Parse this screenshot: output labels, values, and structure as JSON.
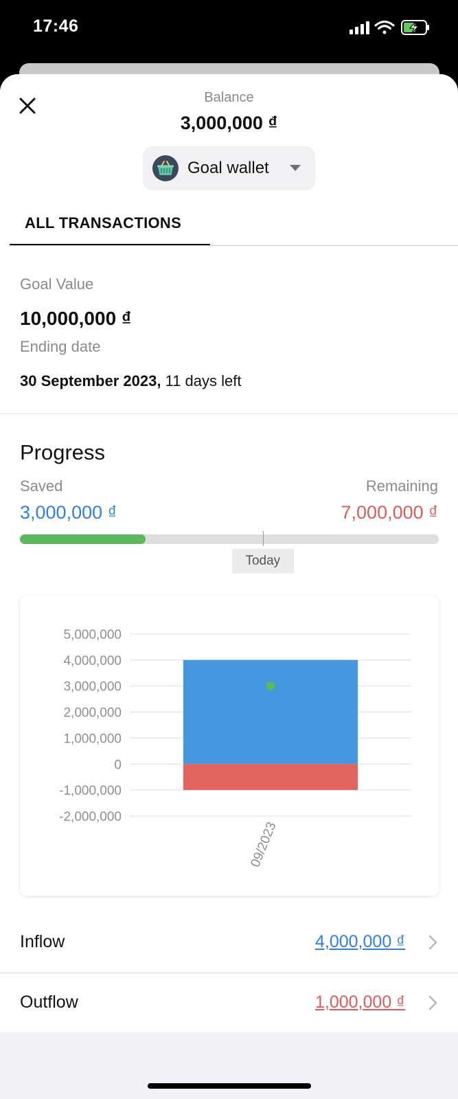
{
  "status_bar": {
    "time": "17:46"
  },
  "header": {
    "balance_label": "Balance",
    "balance_value": "3,000,000 ₫",
    "wallet_name": "Goal wallet",
    "wallet_icon": "basket-icon"
  },
  "tabs": {
    "all_transactions": "ALL TRANSACTIONS"
  },
  "goal": {
    "goal_value_label": "Goal Value",
    "goal_value": "10,000,000 ₫",
    "ending_date_label": "Ending date",
    "ending_date": "30 September 2023,",
    "days_left": "11 days left"
  },
  "progress": {
    "title": "Progress",
    "saved_label": "Saved",
    "saved_value": "3,000,000 ₫",
    "remaining_label": "Remaining",
    "remaining_value": "7,000,000 ₫",
    "fraction_saved": 0.3,
    "today_label": "Today",
    "today_fraction": 0.58
  },
  "chart_data": {
    "type": "bar",
    "categories": [
      "09/2023"
    ],
    "series": [
      {
        "values": [
          4000000
        ],
        "color": "#4598e0"
      },
      {
        "values": [
          -1000000
        ],
        "color": "#e2645f"
      }
    ],
    "points": [
      {
        "x": "09/2023",
        "y": 3000000,
        "color": "#5cb85c"
      }
    ],
    "yticks": [
      "5,000,000",
      "4,000,000",
      "3,000,000",
      "2,000,000",
      "1,000,000",
      "0",
      "-1,000,000",
      "-2,000,000"
    ],
    "ylim": [
      -2000000,
      5000000
    ],
    "grid": true
  },
  "flows": {
    "inflow_label": "Inflow",
    "inflow_value": "4,000,000 ₫",
    "outflow_label": "Outflow",
    "outflow_value": "1,000,000 ₫"
  },
  "colors": {
    "positive": "#2f80ed",
    "negative": "#e05b57",
    "progress": "#5cb85c"
  }
}
